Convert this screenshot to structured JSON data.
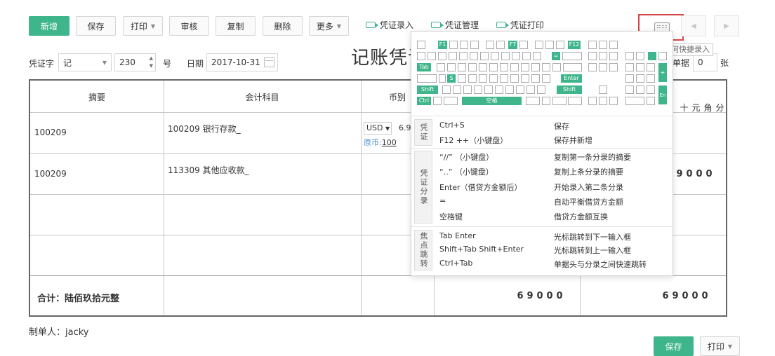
{
  "toolbar": {
    "add": "新增",
    "save": "保存",
    "print": "打印",
    "audit": "审核",
    "copy": "复制",
    "delete": "删除",
    "more": "更多",
    "links": [
      "凭证录入",
      "凭证管理",
      "凭证打印"
    ]
  },
  "tooltip": "如何快捷录入",
  "header": {
    "voucher_word_label": "凭证字",
    "voucher_word_value": "记",
    "number_value": "230",
    "number_label": "号",
    "date_label": "日期",
    "date_value": "2017-10-31",
    "title": "记账凭证",
    "attach_label": "单据",
    "attach_value": "0",
    "attach_unit": "张"
  },
  "table": {
    "col_summary": "摘要",
    "col_account": "会计科目",
    "col_currency": "币别",
    "units": [
      "十",
      "元",
      "角",
      "分"
    ],
    "rows": [
      {
        "summary": "100209",
        "account": "100209 银行存款_",
        "currency": "USD",
        "rate": "6.9",
        "orig_label": "原币:",
        "orig_value": "100"
      },
      {
        "summary": "100209",
        "account": "113309 其他应收款_",
        "credit_digits": [
          "9",
          "0",
          "0",
          "0"
        ]
      }
    ],
    "total_label": "合计：陆佰玖拾元整",
    "total_debit_digits": [
      "6",
      "9",
      "0",
      "0",
      "0"
    ],
    "total_credit_digits": [
      "6",
      "9",
      "0",
      "0",
      "0"
    ]
  },
  "keyboard": {
    "f1": "F1",
    "f7": "F7",
    "f12": "F12",
    "tab": "Tab",
    "s": "S",
    "enter": "Enter",
    "shift_l": "Shift",
    "shift_r": "Shift",
    "ctrl": "Ctrl",
    "space": "空格",
    "equals": "=",
    "plus": "+",
    "numenter": "En"
  },
  "shortcuts": {
    "voucher_tab": "凭证",
    "voucher_items": [
      {
        "key": "Ctrl+S",
        "desc": "保存"
      },
      {
        "key": "F12  ++（小键盘）",
        "desc": "保存并新增"
      }
    ],
    "entry_tab": "凭证分录",
    "entry_items": [
      {
        "key": "“//” （小键盘）",
        "desc": "复制第一条分录的摘要"
      },
      {
        "key": "“..” （小键盘）",
        "desc": "复制上条分录的摘要"
      },
      {
        "key": "Enter（借贷方金额后）",
        "desc": "开始录入第二条分录"
      },
      {
        "key": "=",
        "desc": "自动平衡借贷方金额"
      },
      {
        "key": "空格键",
        "desc": "借贷方金额互换"
      }
    ],
    "focus_tab": "焦点跳转",
    "focus_items": [
      {
        "key": "Tab Enter",
        "desc": "光标跳转到下一输入框"
      },
      {
        "key": "Shift+Tab    Shift+Enter",
        "desc": "光标跳转到上一输入框"
      },
      {
        "key": "Ctrl+Tab",
        "desc": "单据头与分录之间快速跳转"
      }
    ]
  },
  "footer": {
    "maker_label": "制单人：jacky",
    "save": "保存",
    "print": "打印"
  },
  "colors": {
    "accent": "#3fb58b",
    "highlight_border": "#d64545"
  }
}
